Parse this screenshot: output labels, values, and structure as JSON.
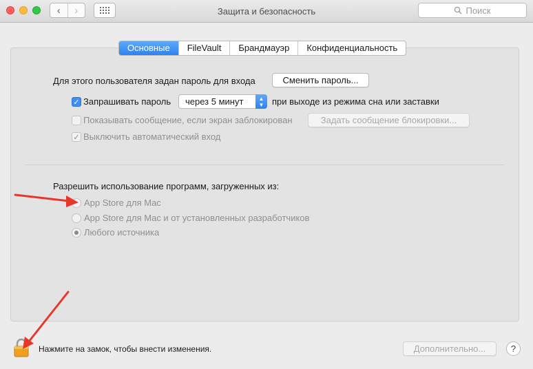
{
  "window": {
    "title": "Защита и безопасность"
  },
  "toolbar": {
    "search_placeholder": "Поиск"
  },
  "tabs": [
    {
      "label": "Основные",
      "active": true
    },
    {
      "label": "FileVault",
      "active": false
    },
    {
      "label": "Брандмауэр",
      "active": false
    },
    {
      "label": "Конфиденциальность",
      "active": false
    }
  ],
  "general": {
    "password_set_label": "Для этого пользователя задан пароль для входа",
    "change_password_button": "Сменить пароль...",
    "require_password": {
      "label": "Запрашивать пароль",
      "checked": true
    },
    "require_password_delay": "через 5 минут",
    "require_password_suffix": "при выходе из режима сна или заставки",
    "show_message": {
      "label": "Показывать сообщение, если экран заблокирован",
      "checked": false
    },
    "set_lock_message_button": "Задать сообщение блокировки...",
    "disable_auto_login": {
      "label": "Выключить автоматический вход",
      "checked": true
    }
  },
  "gatekeeper": {
    "heading": "Разрешить использование программ, загруженных из:",
    "options": [
      {
        "label": "App Store для Mac",
        "selected": false
      },
      {
        "label": "App Store для Mac и от установленных разработчиков",
        "selected": false
      },
      {
        "label": "Любого источника",
        "selected": true
      }
    ]
  },
  "footer": {
    "lock_text": "Нажмите на замок, чтобы внести изменения.",
    "advanced_button": "Дополнительно...",
    "help_glyph": "?"
  },
  "colors": {
    "accent": "#2d82f0",
    "annotation": "#e8362a",
    "lock": "#f0a020"
  }
}
